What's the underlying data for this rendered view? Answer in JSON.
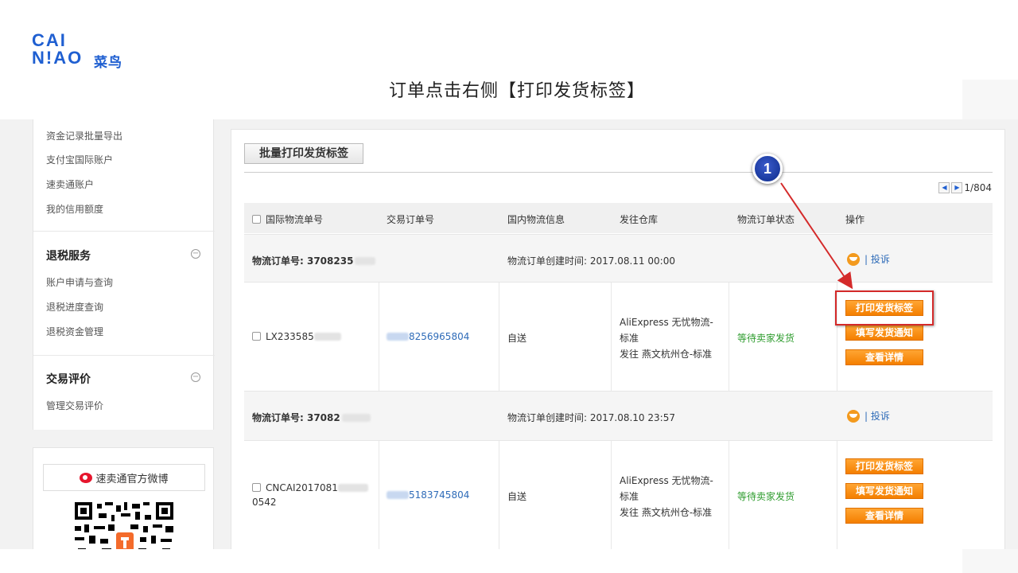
{
  "logo": {
    "line1": "CAI",
    "line2": "N!AO",
    "cn": "菜鸟"
  },
  "slide_title": "订单点击右侧【打印发货标签】",
  "sidebar": {
    "top_links": [
      "资金记录批量导出",
      "支付宝国际账户",
      "速卖通账户",
      "我的信用额度"
    ],
    "section1": {
      "title": "退税服务",
      "toggle": "−",
      "links": [
        "账户申请与查询",
        "退税进度查询",
        "退税资金管理"
      ]
    },
    "section2": {
      "title": "交易评价",
      "toggle": "−",
      "links": [
        "管理交易评价"
      ]
    },
    "weibo_label": "速卖通官方微博"
  },
  "main": {
    "batch_button": "批量打印发货标签",
    "pager": {
      "prev": "◀",
      "next": "▶",
      "text": "1/804"
    },
    "headers": [
      "国际物流单号",
      "交易订单号",
      "国内物流信息",
      "发往仓库",
      "物流订单状态",
      "操作"
    ],
    "orders": [
      {
        "group_label": "物流订单号: 3708235",
        "created": "物流订单创建时间: 2017.08.11 00:00",
        "complain": "| 投诉",
        "tracking_prefix": "LX233585",
        "tracking_suffix": "",
        "trade_suffix": "8256965804",
        "domestic": "自送",
        "warehouse_line1": "AliExpress 无忧物流-",
        "warehouse_line2": "标准",
        "warehouse_line3": "发往 燕文杭州仓-标准",
        "status": "等待卖家发货",
        "actions": [
          "打印发货标签",
          "填写发货通知",
          "查看详情"
        ]
      },
      {
        "group_label": "物流订单号: 37082",
        "created": "物流订单创建时间: 2017.08.10 23:57",
        "complain": "| 投诉",
        "tracking_prefix": "CNCAI2017081",
        "tracking_suffix": "0542",
        "trade_suffix": "5183745804",
        "domestic": "自送",
        "warehouse_line1": "AliExpress 无忧物流-",
        "warehouse_line2": "标准",
        "warehouse_line3": "发往 燕文杭州仓-标准",
        "status": "等待卖家发货",
        "actions": [
          "打印发货标签",
          "填写发货通知",
          "查看详情"
        ]
      }
    ]
  },
  "annotation": {
    "marker": "1"
  },
  "colors": {
    "accent_orange": "#f47f00",
    "brand_blue": "#1f5fd1",
    "highlight_red": "#d42a2a",
    "status_green": "#2e9c2e"
  }
}
